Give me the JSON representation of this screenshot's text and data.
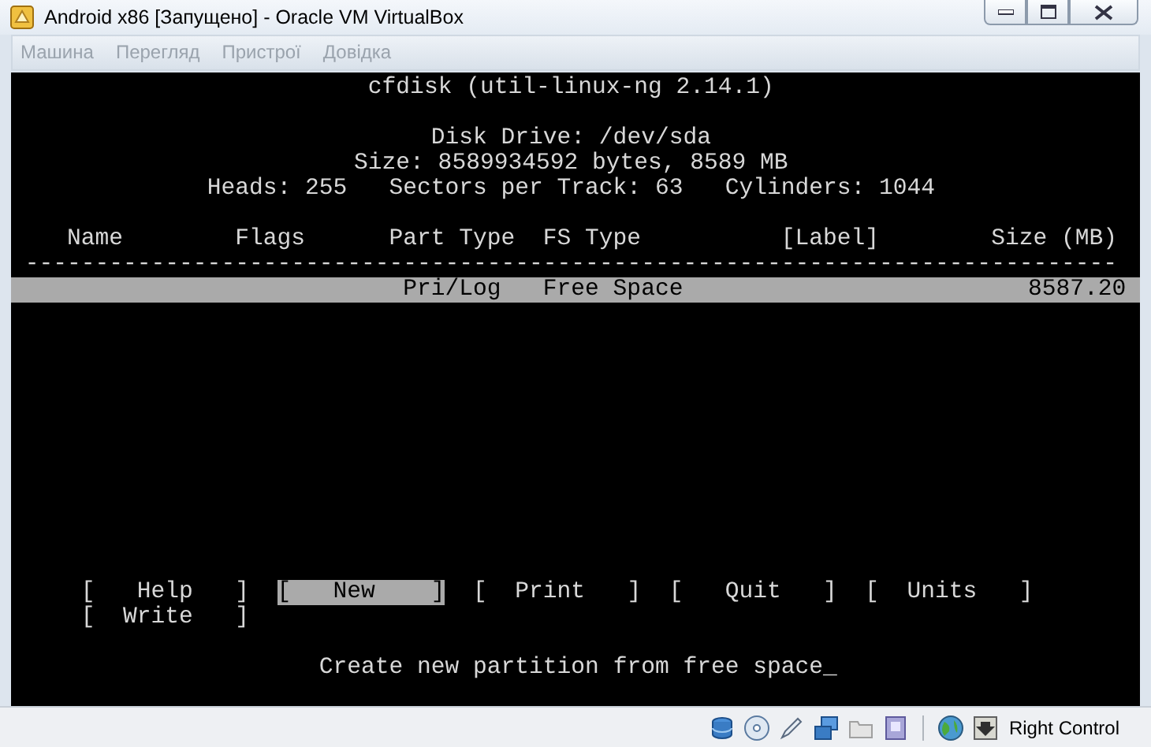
{
  "window": {
    "title": "Android x86 [Запущено] - Oracle VM VirtualBox"
  },
  "menu": [
    {
      "label": "Машина"
    },
    {
      "label": "Перегляд"
    },
    {
      "label": "Пристрої"
    },
    {
      "label": "Довідка"
    }
  ],
  "terminal": {
    "title": "cfdisk (util-linux-ng 2.14.1)",
    "disk_drive": "Disk Drive: /dev/sda",
    "size": "Size: 8589934592 bytes, 8589 MB",
    "geometry": [
      "Heads: 255",
      "Sectors per Track: 63",
      "Cylinders: 1044"
    ],
    "columns": [
      "Name",
      "Flags",
      "Part Type",
      "FS Type",
      "[Label]",
      "Size (MB)"
    ],
    "separator": "------------------------------------------------------------------------------",
    "rows": [
      {
        "part_type": "Pri/Log",
        "fs_type": "Free Space",
        "size": "8587.20",
        "selected": true
      }
    ],
    "commands": [
      {
        "label": "[   Help   ]",
        "selected": false
      },
      {
        "label": "[   New    ]",
        "selected": true
      },
      {
        "label": "[  Print   ]",
        "selected": false
      },
      {
        "label": "[   Quit   ]",
        "selected": false
      },
      {
        "label": "[  Units   ]",
        "selected": false
      },
      {
        "label": "[  Write   ]",
        "selected": false
      }
    ],
    "hint": "Create new partition from free space_"
  },
  "status_bar": {
    "host_key": "Right Control"
  }
}
